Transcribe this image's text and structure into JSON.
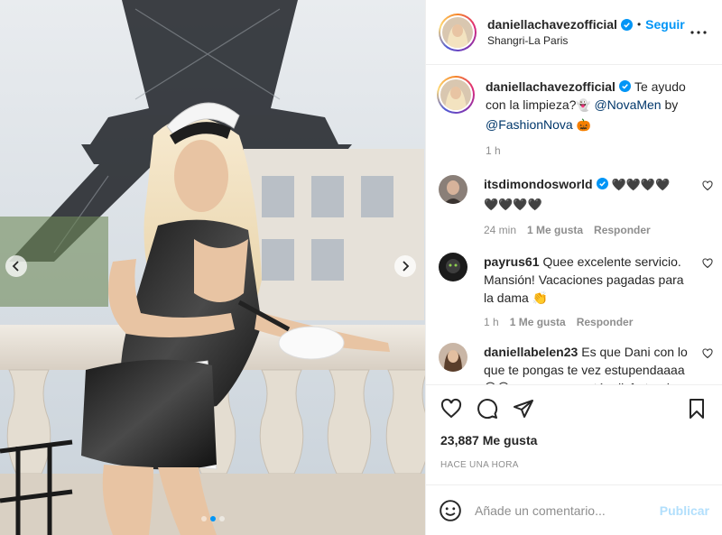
{
  "header": {
    "username": "daniellachavezofficial",
    "separator": "•",
    "follow_label": "Seguir",
    "location": "Shangri-La Paris"
  },
  "caption": {
    "username": "daniellachavezofficial",
    "text_before": "Te ayudo con la limpieza?",
    "emoji_1": "👻",
    "mention_1": "@NovaMen",
    "by_word": "by",
    "mention_2": "@FashionNova",
    "emoji_2": "🎃",
    "age": "1 h"
  },
  "comments": [
    {
      "username": "itsdimondosworld",
      "text": "🖤🖤🖤🖤 🖤🖤🖤🖤",
      "age": "24 min",
      "likes": "1 Me gusta",
      "reply": "Responder"
    },
    {
      "username": "payrus61",
      "text": "Quee excelente servicio. Mansión! Vacaciones pagadas para la dama 👏",
      "age": "1 h",
      "likes": "1 Me gusta",
      "reply": "Responder"
    },
    {
      "username": "daniellabelen23",
      "text": "Es que Dani con lo que te pongas te vez estupendaaaa 😍😍 espero que estés disfrutando"
    }
  ],
  "likes_count": "23,887 Me gusta",
  "posted_time": "HACE UNA HORA",
  "comment_box": {
    "placeholder": "Añade un comentario...",
    "publish_label": "Publicar"
  },
  "carousel": {
    "slide_count": 3,
    "active_index": 1
  },
  "colors": {
    "accent": "#0095f6",
    "publish_disabled": "#b2dffc",
    "muted": "#8e8e8e",
    "text": "#262626",
    "border": "#efefef"
  },
  "icons": [
    "chevron-left-icon",
    "chevron-right-icon",
    "verified-badge-icon",
    "more-options-icon",
    "heart-icon",
    "comment-icon",
    "share-icon",
    "bookmark-icon",
    "emoji-icon"
  ]
}
